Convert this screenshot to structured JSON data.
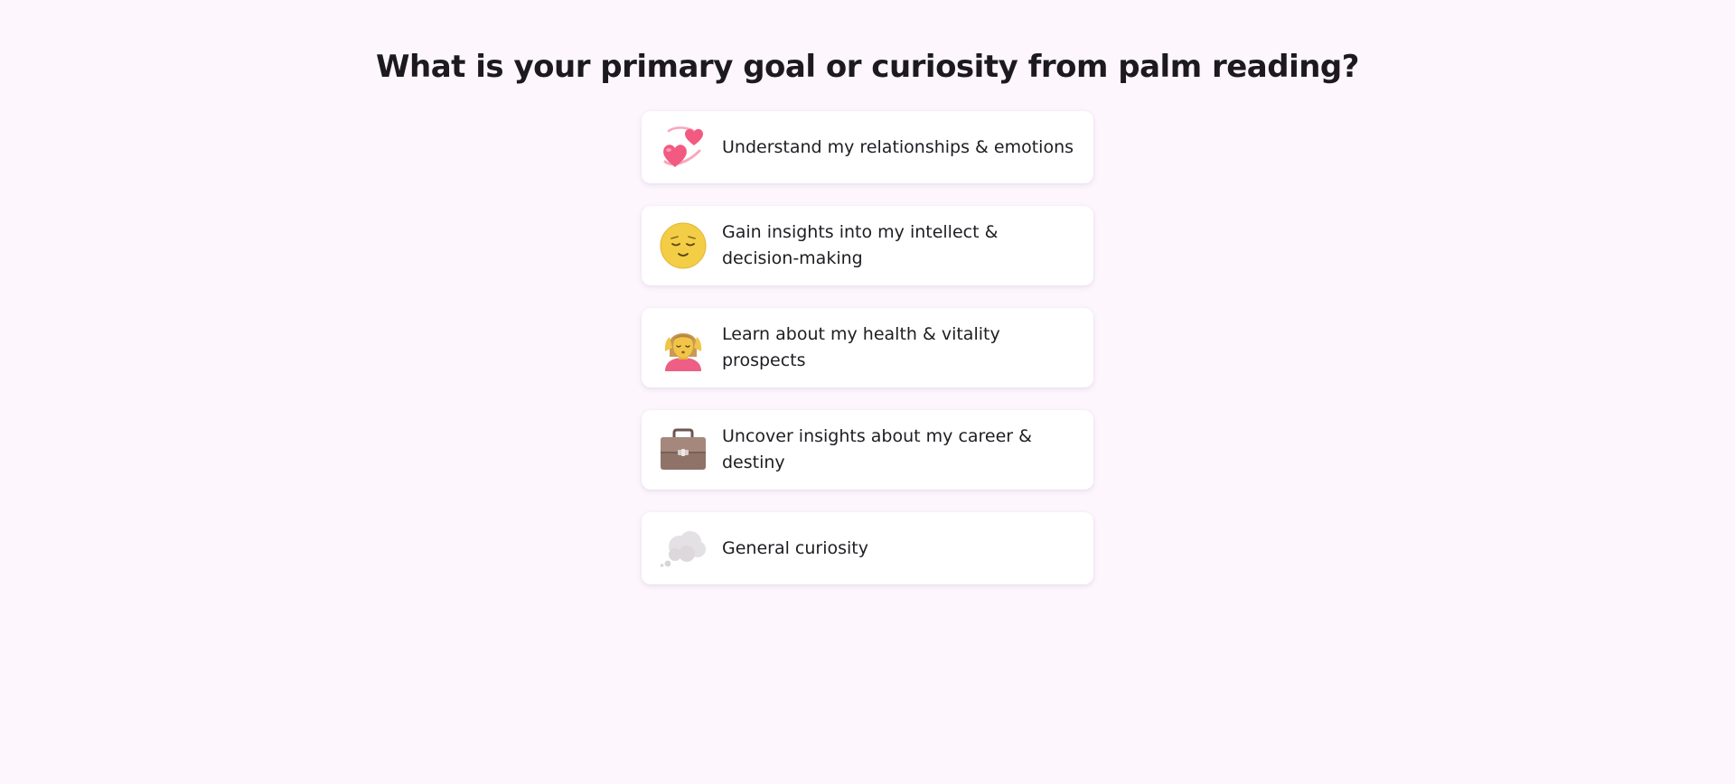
{
  "question": {
    "title": "What is your primary goal or curiosity from palm reading?"
  },
  "options": [
    {
      "label": "Understand my relationships & emotions",
      "icon": "two-hearts-icon"
    },
    {
      "label": "Gain insights into my intellect & decision-making",
      "icon": "relieved-face-icon"
    },
    {
      "label": "Learn about my health & vitality prospects",
      "icon": "person-meditating-icon"
    },
    {
      "label": "Uncover insights about my career & destiny",
      "icon": "briefcase-icon"
    },
    {
      "label": "General curiosity",
      "icon": "thought-bubble-icon"
    }
  ],
  "colors": {
    "background": "#fdf6fd",
    "card": "#ffffff",
    "text": "#1f1d22"
  }
}
